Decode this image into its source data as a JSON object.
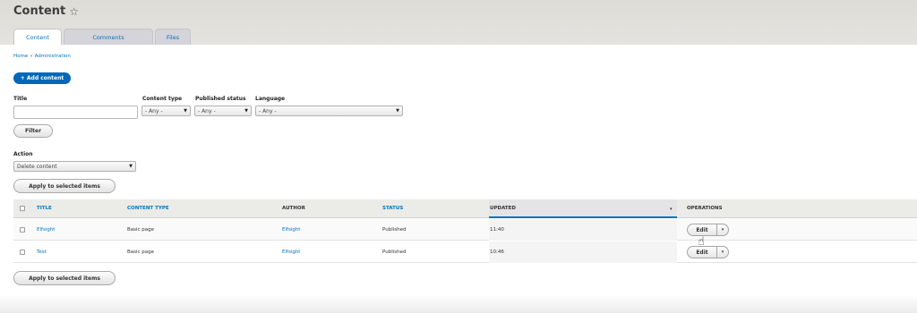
{
  "header": {
    "title": "Content",
    "tabs": [
      {
        "label": "Content",
        "active": true
      },
      {
        "label": "Comments",
        "active": false
      },
      {
        "label": "Files",
        "active": false
      }
    ]
  },
  "breadcrumb": {
    "home": "Home",
    "sep": "»",
    "admin": "Administration"
  },
  "add_content_label": "+ Add content",
  "filters": {
    "title_label": "Title",
    "title_value": "",
    "content_type_label": "Content type",
    "content_type_value": "- Any -",
    "published_label": "Published status",
    "published_value": "- Any -",
    "language_label": "Language",
    "language_value": "- Any -",
    "filter_button": "Filter"
  },
  "action": {
    "label": "Action",
    "value": "Delete content",
    "apply_button": "Apply to selected items"
  },
  "table": {
    "columns": [
      "TITLE",
      "CONTENT TYPE",
      "AUTHOR",
      "STATUS",
      "UPDATED",
      "OPERATIONS"
    ],
    "sort_indicator": "▾",
    "rows": [
      {
        "title": "Elfsight",
        "type": "Basic page",
        "author": "Elfsight",
        "status": "Published",
        "updated": "11:40",
        "op": "Edit"
      },
      {
        "title": "Test",
        "type": "Basic page",
        "author": "Elfsight",
        "status": "Published",
        "updated": "10:46",
        "op": "Edit"
      }
    ]
  },
  "bottom_apply_button": "Apply to selected items",
  "colors": {
    "accent": "#0074bd",
    "primary_button": "#0068b8",
    "header_bg": "#e0dfda"
  }
}
